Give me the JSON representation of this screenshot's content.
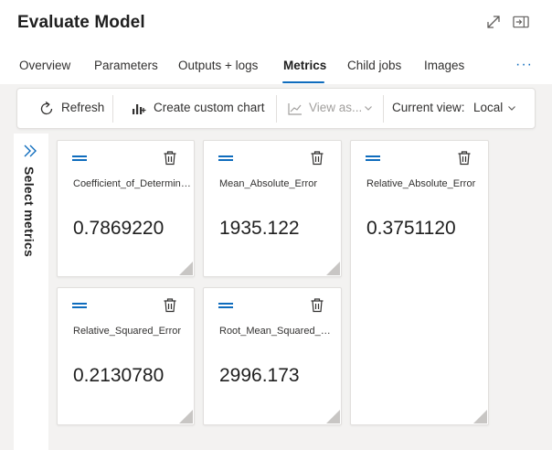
{
  "page": {
    "title": "Evaluate Model"
  },
  "tabs": [
    {
      "label": "Overview"
    },
    {
      "label": "Parameters"
    },
    {
      "label": "Outputs + logs"
    },
    {
      "label": "Metrics",
      "active": true
    },
    {
      "label": "Child jobs"
    },
    {
      "label": "Images"
    }
  ],
  "more_label": "···",
  "toolbar": {
    "refresh_label": "Refresh",
    "create_chart_label": "Create custom chart",
    "view_as_label": "View as...",
    "current_view_label": "Current view:",
    "current_view_value": "Local"
  },
  "left_panel": {
    "label": "Select metrics"
  },
  "metrics": [
    {
      "name": "Coefficient_of_Determination",
      "value": "0.7869220"
    },
    {
      "name": "Mean_Absolute_Error",
      "value": "1935.122"
    },
    {
      "name": "Relative_Absolute_Error",
      "value": "0.3751120"
    },
    {
      "name": "Relative_Squared_Error",
      "value": "0.2130780"
    },
    {
      "name": "Root_Mean_Squared_Error",
      "value": "2996.173"
    }
  ],
  "colors": {
    "accent": "#0f6cbd",
    "background": "#f3f2f1",
    "card": "#ffffff"
  },
  "icons": {
    "expand": "expand-diagonal-icon",
    "panel": "side-panel-icon",
    "refresh": "refresh-icon",
    "chart": "bar-chart-icon",
    "view_as": "line-chart-icon",
    "dropdown": "chevron-down-icon",
    "collapse": "double-chevron-right-icon",
    "drag": "drag-handle-icon",
    "delete": "trash-icon",
    "resize": "resize-handle-icon"
  }
}
